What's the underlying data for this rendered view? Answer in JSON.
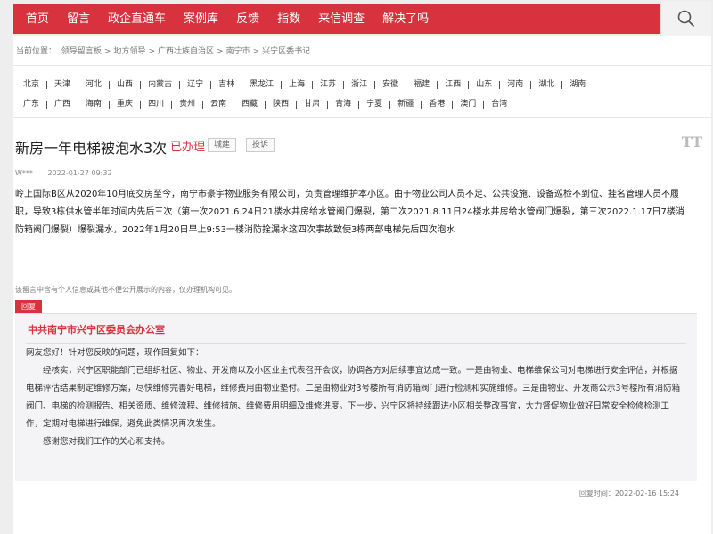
{
  "nav": {
    "items": [
      "首页",
      "留言",
      "政企直通车",
      "案例库",
      "反馈",
      "指数",
      "来信调查",
      "解决了吗"
    ],
    "search_icon": "search-icon"
  },
  "breadcrumb": {
    "label": "当前位置：",
    "parts": [
      "领导留言板",
      "地方领导",
      "广西壮族自治区",
      "南宁市",
      "兴宁区委书记"
    ],
    "sep": ">"
  },
  "regions": [
    [
      "北京",
      "天津",
      "河北",
      "山西",
      "内蒙古",
      "辽宁",
      "吉林",
      "黑龙江",
      "上海",
      "江苏",
      "浙江",
      "安徽",
      "福建",
      "江西",
      "山东",
      "河南",
      "湖北",
      "湖南"
    ],
    [
      "广东",
      "广西",
      "海南",
      "重庆",
      "四川",
      "贵州",
      "云南",
      "西藏",
      "陕西",
      "甘肃",
      "青海",
      "宁夏",
      "新疆",
      "香港",
      "澳门",
      "台湾"
    ]
  ],
  "message": {
    "title": "新房一年电梯被泡水3次",
    "status": "已办理",
    "tags": [
      "城建",
      "投诉"
    ],
    "font_toggle": "TT",
    "author": "W***",
    "date": "2022-01-27 09:32",
    "body": "岭上国际B区从2020年10月底交房至今，南宁市豪宇物业服务有限公司，负责管理维护本小区。由于物业公司人员不足、公共设施、设备巡检不到位、挂名管理人员不履职，导致3栋供水管半年时间内先后三次（第一次2021.6.24日21楼水井房给水管阀门爆裂，第二次2021.8.11日24楼水井房给水管阀门爆裂，第三次2022.1.17日7楼消防箱阀门爆裂）爆裂漏水，2022年1月20日早上9:53一楼消防拴漏水这四次事故致使3栋两部电梯先后四次泡水",
    "disclaimer": "该留言中含有个人信息或其他不便公开展示的内容，仅办理机构可见。"
  },
  "reply": {
    "tag": "回复",
    "org": "中共南宁市兴宁区委员会办公室",
    "greeting": "网友您好！针对您反映的问题，现作回复如下：",
    "para1": "经核实，兴宁区职能部门已组织社区、物业、开发商以及小区业主代表召开会议，协调各方对后续事宜达成一致。一是由物业、电梯维保公司对电梯进行安全评估，并根据电梯评估结果制定维修方案，尽快维修完善好电梯，维修费用由物业垫付。二是由物业对3号楼所有消防箱阀门进行检测和实施维修。三是由物业、开发商公示3号楼所有消防箱阀门、电梯的检测报告、相关资质、维修流程、维修措施、维修费用明细及维修进度。下一步，兴宁区将持续跟进小区相关整改事宜，大力督促物业做好日常安全检修检测工作，定期对电梯进行维保，避免此类情况再次发生。",
    "para2": "感谢您对我们工作的关心和支持。",
    "time": "回复时间：2022-02-16 15:24"
  },
  "colors": {
    "brand_red": "#d7323d"
  }
}
